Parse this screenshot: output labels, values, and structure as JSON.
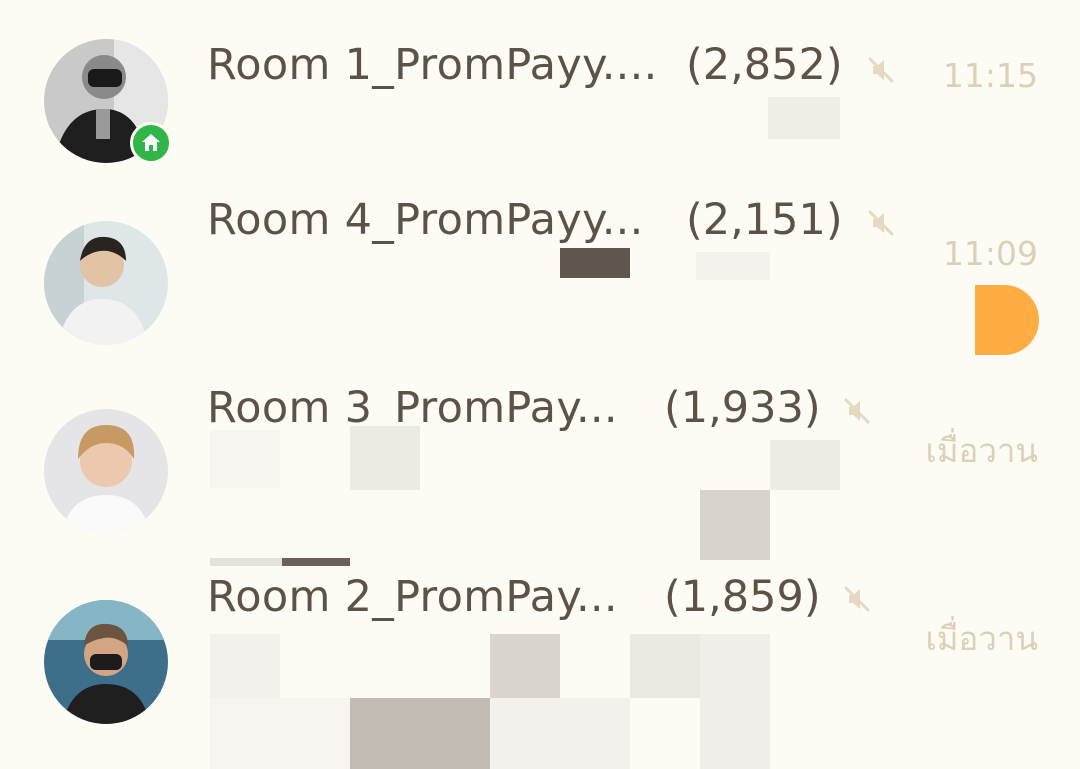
{
  "chats": [
    {
      "name": "Room 1_PromPayy....",
      "count": "(2,852)",
      "time": "11:15",
      "muted": true,
      "badge": "home-icon",
      "avatar": "avatar-icon"
    },
    {
      "name": "Room 4_PromPayy...",
      "count": "(2,151)",
      "time": "11:09",
      "muted": true,
      "avatar": "avatar-icon"
    },
    {
      "name": "Room 3_PromPay...",
      "count": "(1,933)",
      "time": "เมื่อวาน",
      "muted": true,
      "avatar": "avatar-icon"
    },
    {
      "name": "Room 2_PromPay...",
      "count": "(1,859)",
      "time": "เมื่อวาน",
      "muted": true,
      "avatar": "avatar-icon"
    }
  ],
  "colors": {
    "background": "#fdfcf4",
    "text": "#5d5248",
    "time": "#dcd0b8",
    "mute_icon": "#e6d9c3",
    "home_badge": "#2fb548",
    "unread_dot": "#ffac43"
  }
}
